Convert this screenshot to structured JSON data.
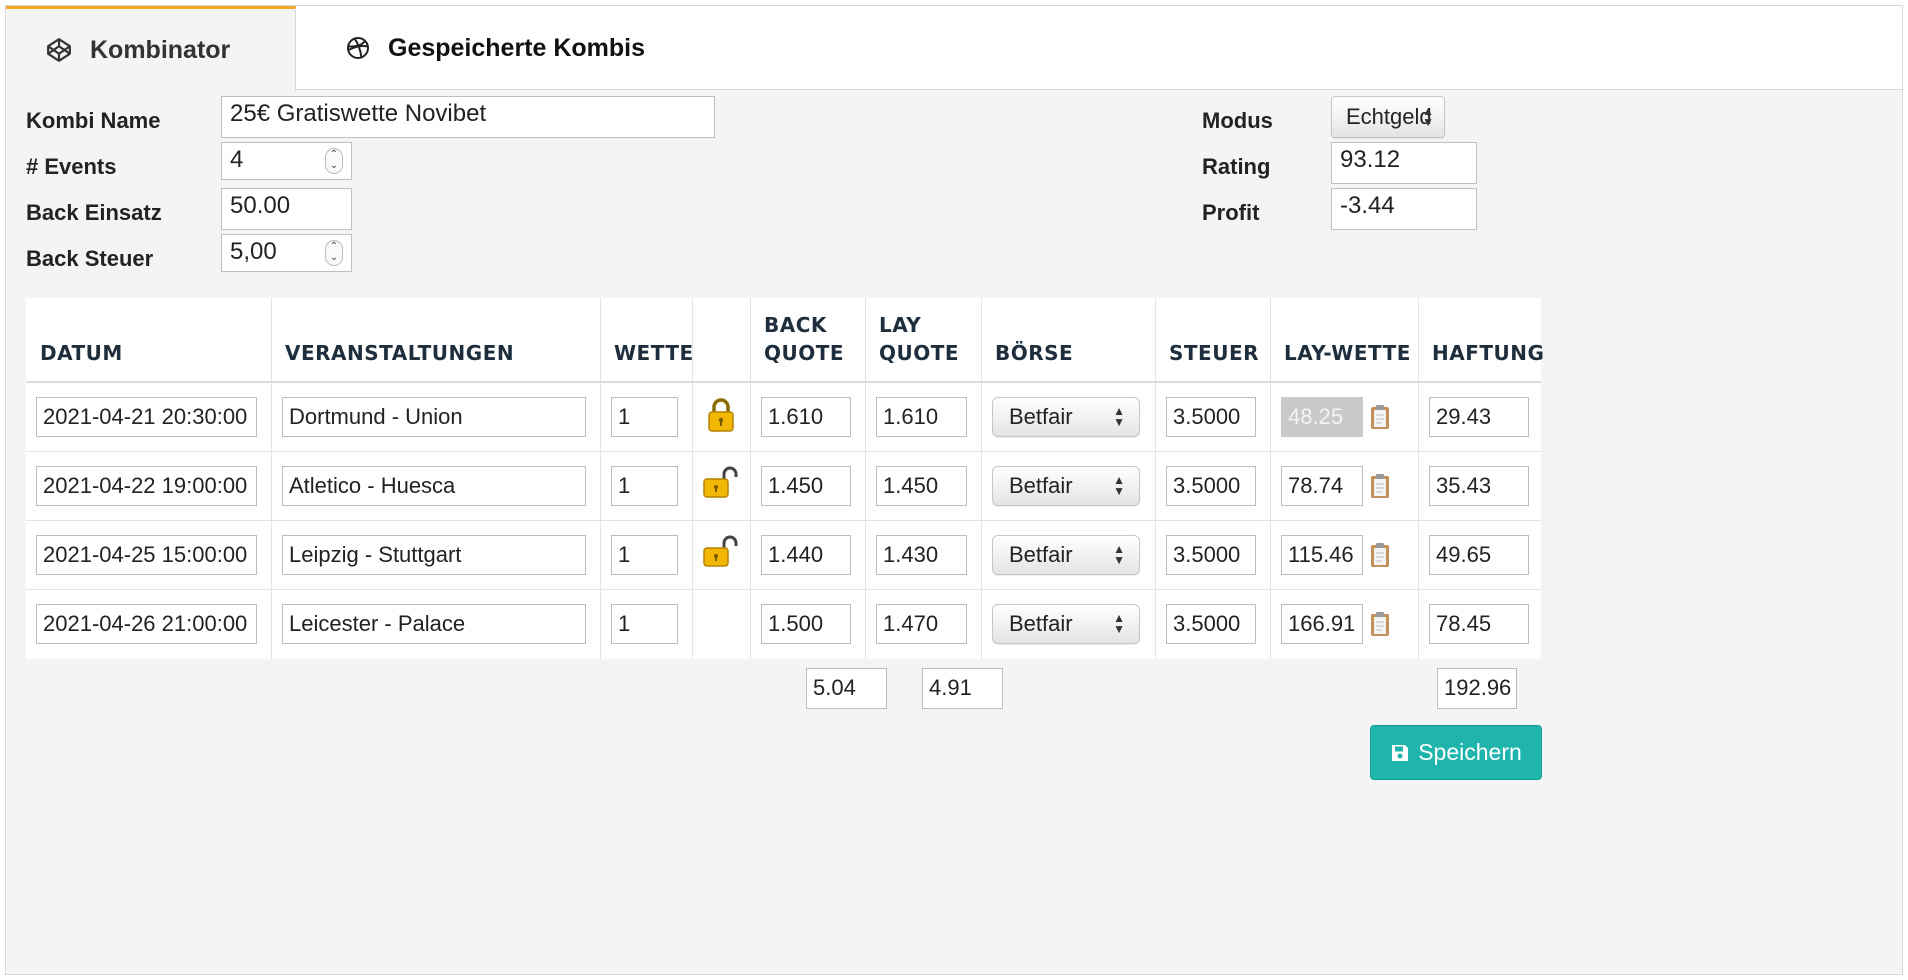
{
  "tabs": [
    {
      "label": "Kombinator",
      "active": true
    },
    {
      "label": "Gespeicherte Kombis",
      "active": false
    }
  ],
  "form": {
    "kombi_name_label": "Kombi Name",
    "kombi_name_value": "25€ Gratiswette Novibet",
    "events_label": "# Events",
    "events_value": "4",
    "back_einsatz_label": "Back Einsatz",
    "back_einsatz_value": "50.00",
    "back_steuer_label": "Back Steuer",
    "back_steuer_value": "5,00",
    "modus_label": "Modus",
    "modus_value": "Echtgeld",
    "rating_label": "Rating",
    "rating_value": "93.12",
    "profit_label": "Profit",
    "profit_value": "-3.44"
  },
  "table": {
    "headers": {
      "datum": "DATUM",
      "veranstaltungen": "VERANSTALTUNGEN",
      "wette": "WETTE",
      "back_quote_1": "BACK",
      "back_quote_2": "QUOTE",
      "lay_quote_1": "LAY",
      "lay_quote_2": "QUOTE",
      "boerse": "BÖRSE",
      "steuer": "STEUER",
      "lay_wette": "LAY-WETTE",
      "haftung": "HAFTUNG"
    },
    "rows": [
      {
        "datum": "2021-04-21 20:30:00",
        "event": "Dortmund - Union",
        "wette": "1",
        "lock": "locked",
        "back": "1.610",
        "lay": "1.610",
        "boerse": "Betfair",
        "steuer": "3.5000",
        "lay_wette": "48.25",
        "lay_wette_disabled": true,
        "haftung": "29.43"
      },
      {
        "datum": "2021-04-22 19:00:00",
        "event": "Atletico - Huesca",
        "wette": "1",
        "lock": "unlocked",
        "back": "1.450",
        "lay": "1.450",
        "boerse": "Betfair",
        "steuer": "3.5000",
        "lay_wette": "78.74",
        "lay_wette_disabled": false,
        "haftung": "35.43"
      },
      {
        "datum": "2021-04-25 15:00:00",
        "event": "Leipzig - Stuttgart",
        "wette": "1",
        "lock": "unlocked",
        "back": "1.440",
        "lay": "1.430",
        "boerse": "Betfair",
        "steuer": "3.5000",
        "lay_wette": "115.46",
        "lay_wette_disabled": false,
        "haftung": "49.65"
      },
      {
        "datum": "2021-04-26 21:00:00",
        "event": "Leicester - Palace",
        "wette": "1",
        "lock": "none",
        "back": "1.500",
        "lay": "1.470",
        "boerse": "Betfair",
        "steuer": "3.5000",
        "lay_wette": "166.91",
        "lay_wette_disabled": false,
        "haftung": "78.45"
      }
    ],
    "totals": {
      "back": "5.04",
      "lay": "4.91",
      "haftung": "192.96"
    }
  },
  "buttons": {
    "save_label": "Speichern"
  },
  "colors": {
    "accent_tab": "#f5a623",
    "save_button": "#1fb5ad",
    "lock": "#f2b705"
  },
  "icons": {
    "tab1": "codepen-icon",
    "tab2": "dribbble-icon",
    "lock": "lock-icon",
    "unlock": "unlock-icon",
    "clipboard": "clipboard-icon",
    "save": "floppy-disk-icon"
  }
}
